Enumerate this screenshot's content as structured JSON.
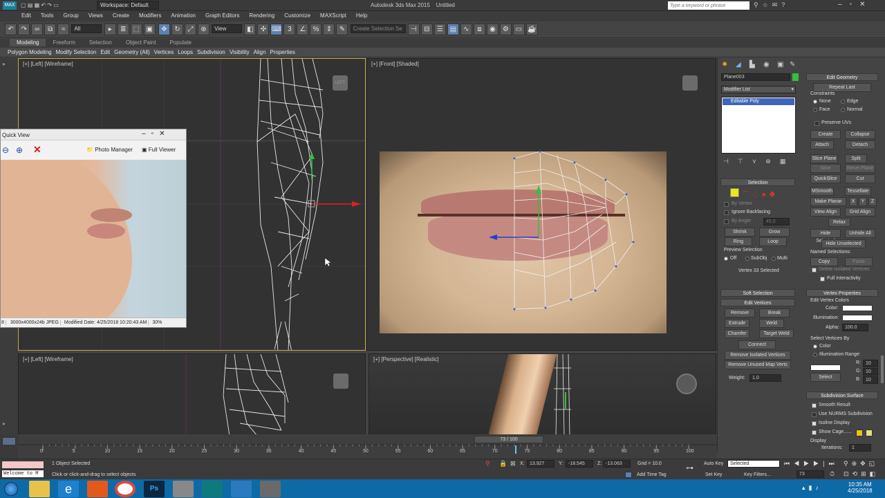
{
  "titlebar": {
    "workspace": "Workspace: Default",
    "title": "Autodesk 3ds Max 2015",
    "doc": "Untitled",
    "search_placeholder": "Type a keyword or phrase"
  },
  "menu": [
    "Edit",
    "Tools",
    "Group",
    "Views",
    "Create",
    "Modifiers",
    "Animation",
    "Graph Editors",
    "Rendering",
    "Customize",
    "MAXScript",
    "Help"
  ],
  "toolbar": {
    "filter": "All",
    "refcoord": "View",
    "selset": "Create Selection Se"
  },
  "ribbon_tabs": [
    "Modeling",
    "Freeform",
    "Selection",
    "Object Paint",
    "Populate"
  ],
  "ribbon_items": [
    "Polygon Modeling",
    "Modify Selection",
    "Edit",
    "Geometry (All)",
    "Vertices",
    "Loops",
    "Subdivision",
    "Visibility",
    "Align",
    "Properties"
  ],
  "viewports": {
    "topleft": "[+] [Left] [Wireframe]",
    "topright": "[+] [Front] [Shaded]",
    "bottomleft": "[+] [Left] [Wireframe]",
    "bottomright": "[+] [Perspective] [Realistic]",
    "cube": "LEFT"
  },
  "quickview": {
    "title": "Quick View",
    "photo_manager": "Photo Manager",
    "full_viewer": "Full Viewer",
    "status_dims": "3000x4000x24b JPEG",
    "status_mod": "Modified Date: 4/25/2018 10:20:43 AM",
    "status_zoom": "30%",
    "left_fragment": "8"
  },
  "cmd": {
    "object_name": "Plane003",
    "modifier_list": "Modifier List",
    "stack_item": "Editable Poly",
    "selection_title": "Selection",
    "by_vertex": "By Vertex",
    "ignore_backfacing": "Ignore Backfacing",
    "by_angle": "By Angle:",
    "angle_val": "45.0",
    "shrink": "Shrink",
    "grow": "Grow",
    "ring": "Ring",
    "loop": "Loop",
    "preview_selection": "Preview Selection",
    "off": "Off",
    "subobj": "SubObj",
    "multi": "Multi",
    "vertices_selected": "Vertex 33 Selected",
    "soft_selection": "Soft Selection",
    "edit_vertices": "Edit Vertices",
    "remove": "Remove",
    "break": "Break",
    "extrude": "Extrude",
    "weld": "Weld",
    "chamfer": "Chamfer",
    "target_weld": "Target Weld",
    "connect": "Connect",
    "remove_isolated": "Remove Isolated Vertices",
    "remove_unused": "Remove Unused Map Verts",
    "weight_lbl": "Weight:",
    "weight_val": "1.0",
    "edit_geometry": "Edit Geometry",
    "repeat_last": "Repeat Last",
    "constraints": "Constraints",
    "none": "None",
    "edge": "Edge",
    "face": "Face",
    "normal": "Normal",
    "preserve_uvs": "Preserve UVs",
    "create": "Create",
    "collapse": "Collapse",
    "attach": "Attach",
    "detach": "Detach",
    "slice_plane": "Slice Plane",
    "split": "Split",
    "slice": "Slice",
    "reset_plane": "Reset Plane",
    "quickslice": "QuickSlice",
    "cut": "Cut",
    "msmooth": "MSmooth",
    "tessellate": "Tessellate",
    "make_planar": "Make Planar",
    "x": "X",
    "y": "Y",
    "z": "Z",
    "view_align": "View Align",
    "grid_align": "Grid Align",
    "relax": "Relax",
    "hide_selected": "Hide Selected",
    "unhide_all": "Unhide All",
    "hide_unselected": "Hide Unselected",
    "named_selections": "Named Selections:",
    "copy": "Copy",
    "paste": "Paste",
    "delete_isolated": "Delete Isolated Vertices",
    "full_interactivity": "Full Interactivity",
    "vertex_properties": "Vertex Properties",
    "edit_vertex_colors": "Edit Vertex Colors",
    "color": "Color:",
    "illumination": "Illumination:",
    "alpha": "Alpha:",
    "alpha_val": "100.0",
    "select_vertices_by": "Select Vertices By",
    "color_opt": "Color",
    "illum_opt": "Illumination",
    "range": "Range:",
    "r": "R:",
    "g": "G:",
    "b": "B:",
    "range_val": "10",
    "select": "Select",
    "subdivision_surface": "Subdivision Surface",
    "smooth_result": "Smooth Result",
    "use_nurms": "Use NURMS Subdivision",
    "isoline": "Isoline Display",
    "show_cage": "Show Cage......",
    "display": "Display",
    "iterations": "Iterations:",
    "iterations_val": "1"
  },
  "timeline": {
    "frame": "73 / 100",
    "ticks": [
      "0",
      "5",
      "10",
      "15",
      "20",
      "25",
      "30",
      "35",
      "40",
      "45",
      "50",
      "55",
      "60",
      "65",
      "70",
      "75",
      "80",
      "85",
      "90",
      "95",
      "100"
    ]
  },
  "status": {
    "objects_selected": "1 Object Selected",
    "prompt": "Click or click-and-drag to select objects",
    "maxscript": "Welcome to M",
    "x": "13.927",
    "y": "-18.545",
    "z": "-13.063",
    "grid": "Grid = 10.0",
    "add_time_tag": "Add Time Tag",
    "auto_key": "Auto Key",
    "selected": "Selected",
    "set_key": "Set Key",
    "key_filters": "Key Filters...",
    "frame_field": "73"
  },
  "clock": {
    "time": "10:35 AM",
    "date": "4/25/2018"
  },
  "colors": {
    "accent": "#5b7fb3",
    "active_viewport": "#c9a84a",
    "taskbar": "#0e6aa6",
    "object_color": "#35c040"
  }
}
